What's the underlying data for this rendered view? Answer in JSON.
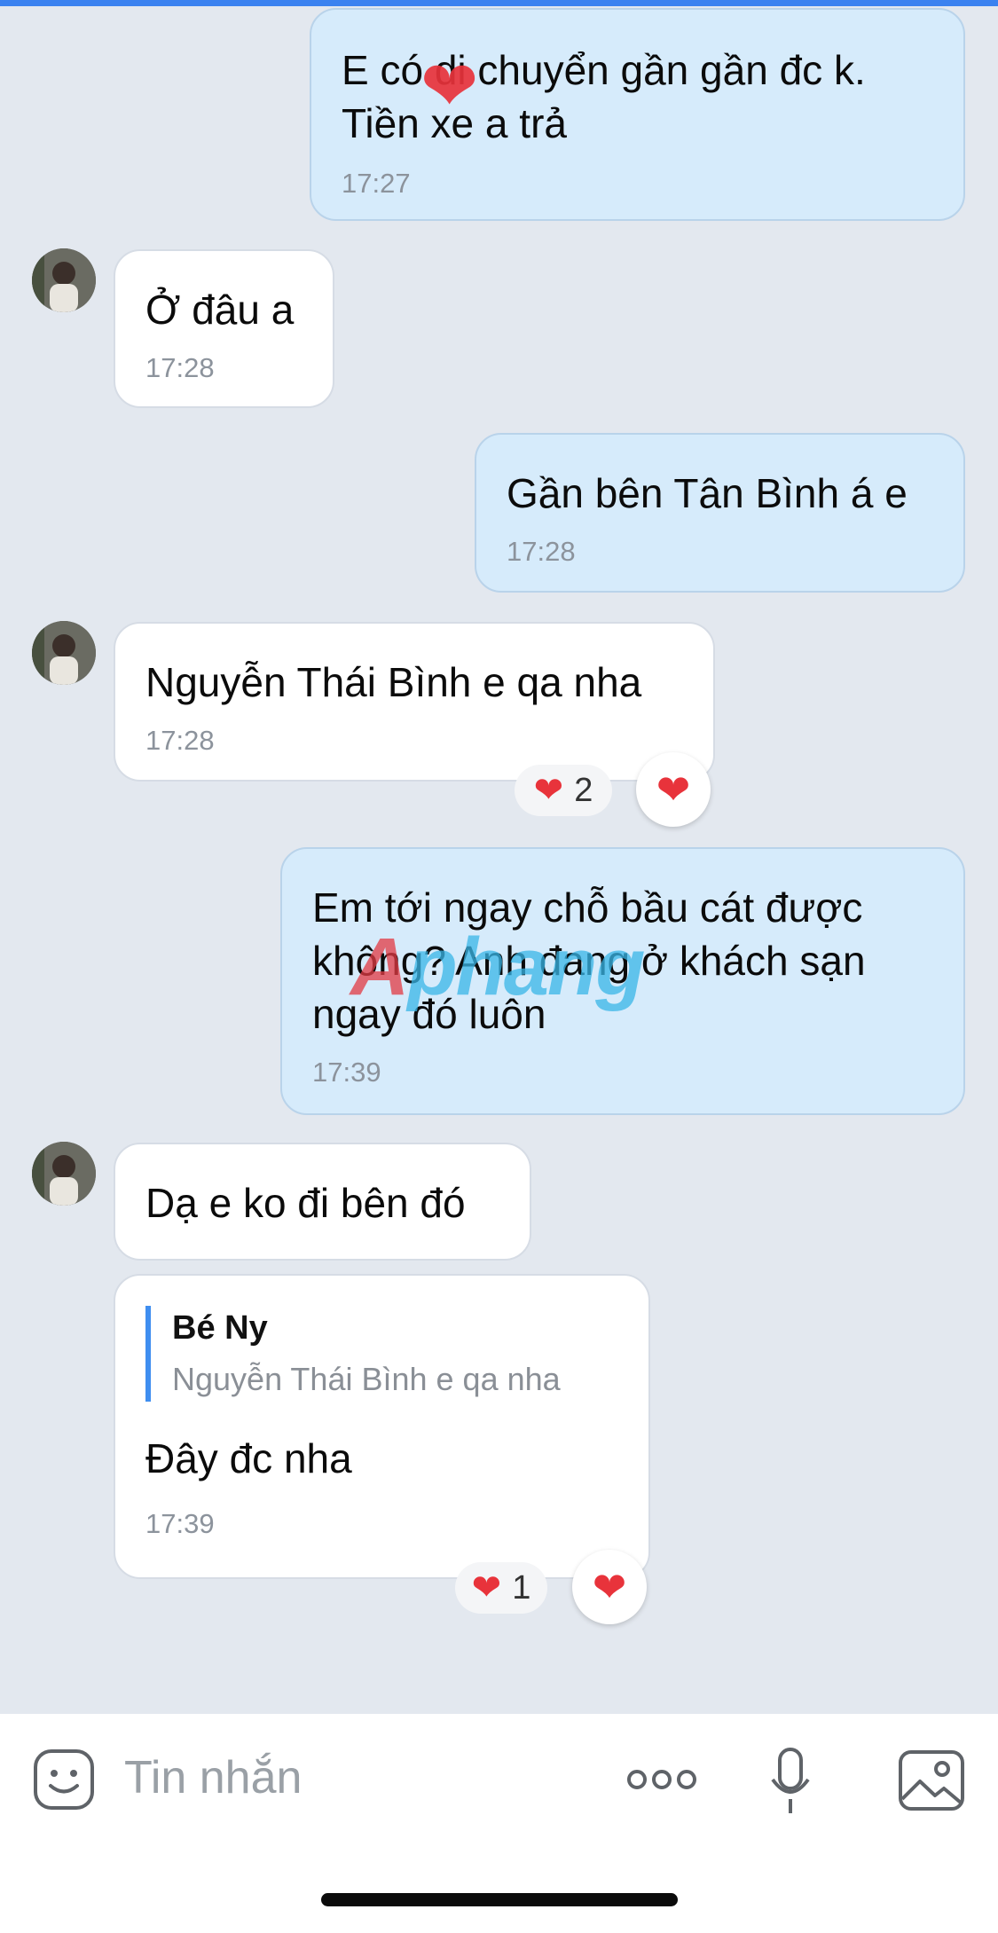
{
  "messages": [
    {
      "text": "E có di chuyển gần gần đc k.\nTiền xe a trả",
      "time": "17:27"
    },
    {
      "text": "Ở đâu a",
      "time": "17:28"
    },
    {
      "text": "Gần bên Tân Bình á e",
      "time": "17:28"
    },
    {
      "text": "Nguyễn Thái Bình e qa nha",
      "time": "17:28",
      "reaction_count": "2"
    },
    {
      "text": "Em tới ngay chỗ bầu cát được\nkhông? Anh đang ở khách sạn\nngay đó luôn",
      "time": "17:39"
    },
    {
      "text": "Dạ e ko đi bên đó"
    },
    {
      "reply_to_name": "Bé Ny",
      "reply_to_text": "Nguyễn Thái Bình e qa nha",
      "text": "Đây đc nha",
      "time": "17:39",
      "reaction_count": "1"
    }
  ],
  "reaction_glyph": "❤",
  "watermark": {
    "part1": "A",
    "part2": "phang"
  },
  "composer": {
    "placeholder": "Tin nhắn"
  },
  "icons": [
    "emoji-icon",
    "more-icon",
    "microphone-icon",
    "image-icon",
    "heart-icon"
  ],
  "colors": {
    "accent": "#3b82f0",
    "outgoing_bubble": "#d6ebfb",
    "incoming_bubble": "#ffffff",
    "reaction": "#e8333b"
  }
}
